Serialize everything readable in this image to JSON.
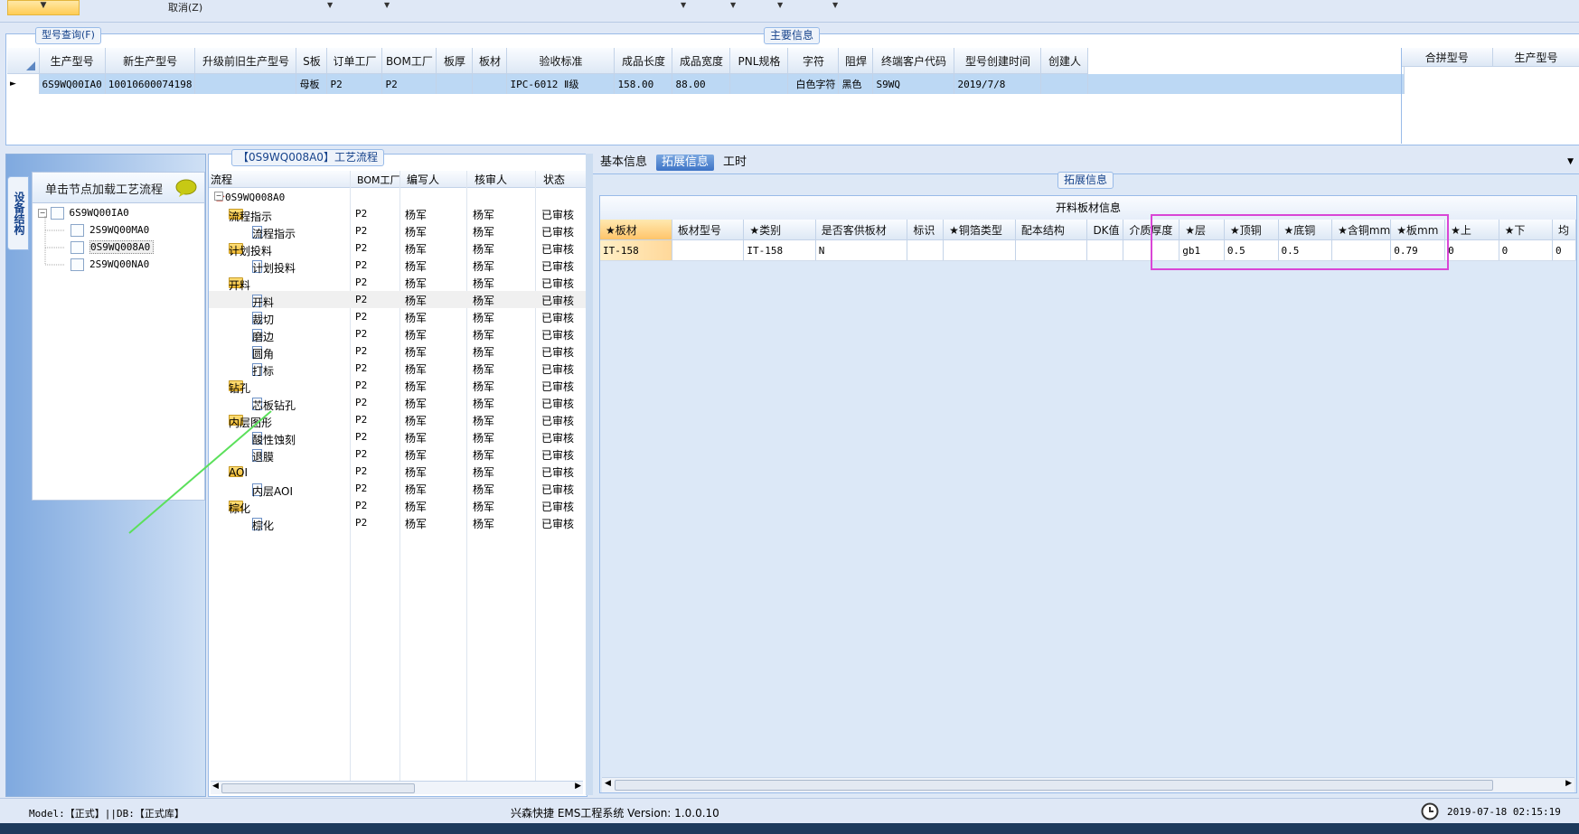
{
  "toolbar": {
    "cancel_label": "取消(Z)"
  },
  "model_query": {
    "caption": "型号查询(F)"
  },
  "main_info": {
    "caption": "主要信息",
    "columns": [
      "生产型号",
      "新生产型号",
      "升级前旧生产型号",
      "S板",
      "订单工厂",
      "BOM工厂",
      "板厚",
      "板材",
      "验收标准",
      "成品长度",
      "成品宽度",
      "PNL规格",
      "字符",
      "阻焊",
      "终端客户代码",
      "型号创建时间",
      "创建人"
    ],
    "row": {
      "生产型号": "6S9WQ00IA0",
      "新生产型号": "10010600074198",
      "升级前旧生产型号": "",
      "S板": "母板",
      "订单工厂": "P2",
      "BOM工厂": "P2",
      "板厚": "",
      "板材": "",
      "验收标准": "IPC-6012 Ⅱ级",
      "成品长度": "158.00",
      "成品宽度": "88.00",
      "PNL规格": "",
      "字符": "白色字符",
      "阻焊": "黑色",
      "终端客户代码": "S9WQ",
      "型号创建时间": "2019/7/8",
      "创建人": ""
    },
    "side_columns": [
      "合拼型号",
      "生产型号"
    ]
  },
  "left_panel": {
    "side_tab": "设备结构",
    "header": "单击节点加载工艺流程",
    "tree": [
      {
        "label": "6S9WQ00IA0",
        "level": 0
      },
      {
        "label": "2S9WQ00MA0",
        "level": 1
      },
      {
        "label": "0S9WQ008A0",
        "level": 1,
        "selected": true
      },
      {
        "label": "2S9WQ00NA0",
        "level": 1
      }
    ]
  },
  "process": {
    "caption": "【0S9WQ008A0】工艺流程",
    "columns": {
      "flow": "流程",
      "bom": "BOM工厂",
      "writer": "编写人",
      "reviewer": "核审人",
      "status": "状态"
    },
    "rows": [
      {
        "label": "0S9WQ008A0",
        "type": "root",
        "level": 0,
        "bom": "",
        "writer": "",
        "reviewer": "",
        "status": ""
      },
      {
        "label": "流程指示",
        "type": "folder",
        "level": 1,
        "bom": "P2",
        "writer": "杨军",
        "reviewer": "杨军",
        "status": "已审核"
      },
      {
        "label": "流程指示",
        "type": "doc",
        "level": 2,
        "bom": "P2",
        "writer": "杨军",
        "reviewer": "杨军",
        "status": "已审核"
      },
      {
        "label": "计划投料",
        "type": "folder",
        "level": 1,
        "bom": "P2",
        "writer": "杨军",
        "reviewer": "杨军",
        "status": "已审核"
      },
      {
        "label": "计划投料",
        "type": "doc",
        "level": 2,
        "bom": "P2",
        "writer": "杨军",
        "reviewer": "杨军",
        "status": "已审核"
      },
      {
        "label": "开料",
        "type": "folder",
        "level": 1,
        "bom": "P2",
        "writer": "杨军",
        "reviewer": "杨军",
        "status": "已审核"
      },
      {
        "label": "开料",
        "type": "doc",
        "level": 2,
        "bom": "P2",
        "writer": "杨军",
        "reviewer": "杨军",
        "status": "已审核",
        "highlight": true
      },
      {
        "label": "裁切",
        "type": "doc",
        "level": 2,
        "bom": "P2",
        "writer": "杨军",
        "reviewer": "杨军",
        "status": "已审核"
      },
      {
        "label": "磨边",
        "type": "doc",
        "level": 2,
        "bom": "P2",
        "writer": "杨军",
        "reviewer": "杨军",
        "status": "已审核"
      },
      {
        "label": "圆角",
        "type": "doc",
        "level": 2,
        "bom": "P2",
        "writer": "杨军",
        "reviewer": "杨军",
        "status": "已审核"
      },
      {
        "label": "打标",
        "type": "doc",
        "level": 2,
        "bom": "P2",
        "writer": "杨军",
        "reviewer": "杨军",
        "status": "已审核"
      },
      {
        "label": "钻孔",
        "type": "folder",
        "level": 1,
        "bom": "P2",
        "writer": "杨军",
        "reviewer": "杨军",
        "status": "已审核"
      },
      {
        "label": "芯板钻孔",
        "type": "doc",
        "level": 2,
        "bom": "P2",
        "writer": "杨军",
        "reviewer": "杨军",
        "status": "已审核"
      },
      {
        "label": "内层图形",
        "type": "folder",
        "level": 1,
        "bom": "P2",
        "writer": "杨军",
        "reviewer": "杨军",
        "status": "已审核"
      },
      {
        "label": "酸性蚀刻",
        "type": "doc",
        "level": 2,
        "bom": "P2",
        "writer": "杨军",
        "reviewer": "杨军",
        "status": "已审核"
      },
      {
        "label": "退膜",
        "type": "doc",
        "level": 2,
        "bom": "P2",
        "writer": "杨军",
        "reviewer": "杨军",
        "status": "已审核"
      },
      {
        "label": "AOI",
        "type": "folder",
        "level": 1,
        "bom": "P2",
        "writer": "杨军",
        "reviewer": "杨军",
        "status": "已审核"
      },
      {
        "label": "内层AOI",
        "type": "doc",
        "level": 2,
        "bom": "P2",
        "writer": "杨军",
        "reviewer": "杨军",
        "status": "已审核"
      },
      {
        "label": "棕化",
        "type": "folder",
        "level": 1,
        "bom": "P2",
        "writer": "杨军",
        "reviewer": "杨军",
        "status": "已审核"
      },
      {
        "label": "棕化",
        "type": "doc",
        "level": 2,
        "bom": "P2",
        "writer": "杨军",
        "reviewer": "杨军",
        "status": "已审核"
      }
    ]
  },
  "right_panel": {
    "tabs": [
      {
        "label": "基本信息",
        "active": false
      },
      {
        "label": "拓展信息",
        "active": true
      },
      {
        "label": "工时",
        "active": false
      }
    ],
    "caption": "拓展信息",
    "board_title": "开料板材信息",
    "columns": [
      "★板材",
      "板材型号",
      "★类别",
      "是否客供板材",
      "标识",
      "★铜箔类型",
      "配本结构",
      "DK值",
      "介质厚度",
      "★层",
      "★顶铜",
      "★底铜",
      "★含铜mm",
      "★板mm",
      "★上",
      "★下",
      "均"
    ],
    "row": [
      "IT-158",
      "",
      "IT-158",
      "N",
      "",
      "",
      "",
      "",
      "",
      "gb1",
      "0.5",
      "0.5",
      "",
      "0.79",
      "0",
      "0",
      "0"
    ]
  },
  "status": {
    "model_text": "Model:【正式】||DB:【正式库】",
    "app_text": "兴森快捷 EMS工程系统 Version: 1.0.0.10",
    "time": "2019-07-18 02:15:19"
  }
}
